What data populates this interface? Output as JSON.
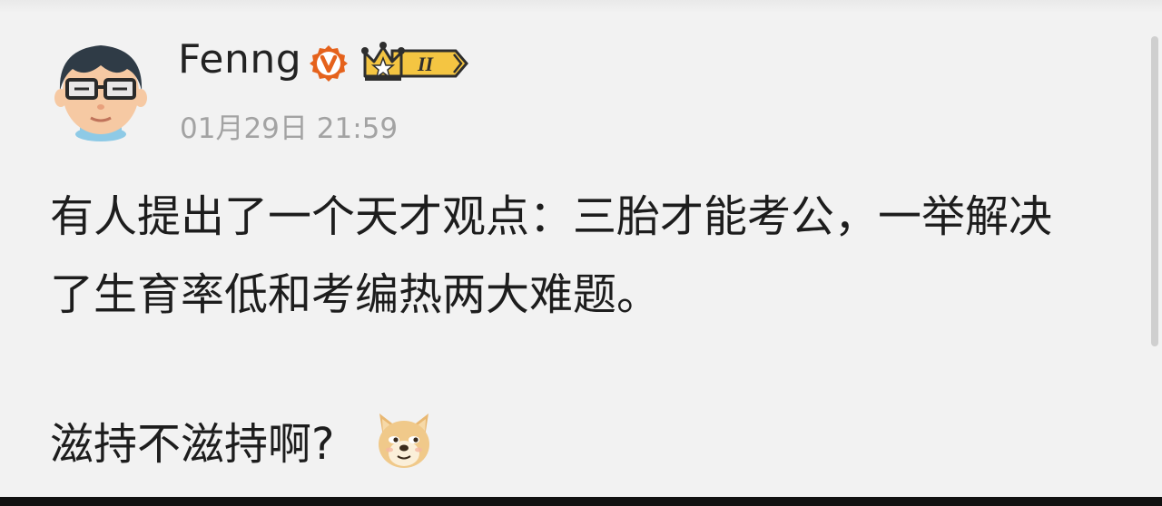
{
  "post": {
    "author": "Fenng",
    "badge_level": "II",
    "timestamp": "01月29日 21:59",
    "text_line_1": "有人提出了一个天才观点：三胎才能考公，一举解决",
    "text_line_2": "了生育率低和考编热两大难题。",
    "text_line_3": "滋持不滋持啊?"
  },
  "icons": {
    "avatar": "cartoon-avatar-with-glasses",
    "verified": "verified-v-icon",
    "crown_badge": "crown-member-badge-icon",
    "emoji": "doge-emoji-icon"
  },
  "colors": {
    "verified": "#e5621c",
    "badge_gold": "#f4c542",
    "timestamp": "#a3a3a3"
  }
}
